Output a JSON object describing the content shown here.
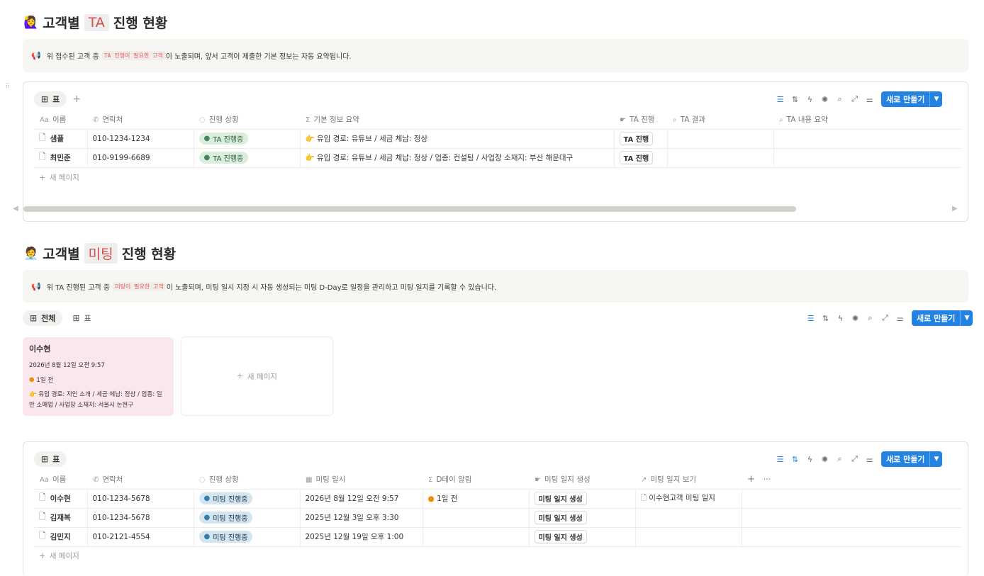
{
  "section1": {
    "emoji": "🙋‍♀️",
    "title_pre": "고객별",
    "title_hl": "TA",
    "title_post": "진행 현황",
    "callout": {
      "icon": "📢",
      "pre": "위 접수된 고객 중",
      "code": "TA 진행이 필요한 고객",
      "post": "이 노출되며, 앞서 고객이 제출한 기본 정보는 자동 요약됩니다."
    },
    "view_tab": "표",
    "add_view": "+",
    "new_button": "새로 만들기",
    "columns": [
      "이름",
      "연락처",
      "진행 상황",
      "기본 정보 요약",
      "TA 진행",
      "TA 결과",
      "TA 내용 요약"
    ],
    "rows": [
      {
        "name": "샘플",
        "phone": "010-1234-1234",
        "status": "TA 진행중",
        "summary": "유입 경로: 유튜브 / 세금 체납: 정상",
        "ta_button": "TA 진행",
        "result": "",
        "content": ""
      },
      {
        "name": "최민준",
        "phone": "010-9199-6689",
        "status": "TA 진행중",
        "summary": "유입 경로: 유튜브 / 세금 체납: 정상 / 업종: 컨설팅 / 사업장 소재지: 부산 해운대구",
        "ta_button": "TA 진행",
        "result": "",
        "content": ""
      }
    ],
    "new_page": "새 페이지"
  },
  "section2": {
    "emoji": "🧑‍💼",
    "title_pre": "고객별",
    "title_hl": "미팅",
    "title_post": "진행 현황",
    "callout": {
      "icon": "📢",
      "pre": "위 TA 진행된 고객 중",
      "code": "미팅이 필요한 고객",
      "post": "이 노출되며, 미팅 일시 지정 시 자동 생성되는 미팅 D-Day로 일정을 관리하고 미팅 일지를 기록할 수 있습니다."
    },
    "tabs": [
      "전체",
      "표"
    ],
    "new_button": "새로 만들기",
    "card": {
      "name": "이수현",
      "datetime": "2026년 8월 12일 오전 9:57",
      "dday": "1일 전",
      "summary": "유입 경로: 지인 소개 / 세금 체납: 정상 / 업종: 일반 소매업 / 사업장 소재지: 서울시 논현구"
    },
    "card_new_page": "새 페이지"
  },
  "section3": {
    "view_tab": "표",
    "new_button": "새로 만들기",
    "columns": [
      "이름",
      "연락처",
      "진행 상황",
      "미팅 일시",
      "D데이 알림",
      "미팅 일지 생성",
      "미팅 일지 보기"
    ],
    "add_col": "+",
    "more": "···",
    "rows": [
      {
        "name": "이수현",
        "phone": "010-1234-5678",
        "status": "미팅 진행중",
        "datetime": "2026년 8월 12일 오전 9:57",
        "dday": "1일 전",
        "gen": "미팅 일지 생성",
        "view": "이수현고객 미팅 일지"
      },
      {
        "name": "김재복",
        "phone": "010-1234-5678",
        "status": "미팅 진행중",
        "datetime": "2025년 12월 3일 오후 3:30",
        "dday": "",
        "gen": "미팅 일지 생성",
        "view": ""
      },
      {
        "name": "김민지",
        "phone": "010-2121-4554",
        "status": "미팅 진행중",
        "datetime": "2025년 12월 19일 오후 1:00",
        "dday": "",
        "gen": "미팅 일지 생성",
        "view": ""
      }
    ],
    "new_page": "새 페이지"
  },
  "colors": {
    "accent": "#2383e2",
    "card_bg": "#fae6ed",
    "callout_bg": "#f7f6f3"
  }
}
